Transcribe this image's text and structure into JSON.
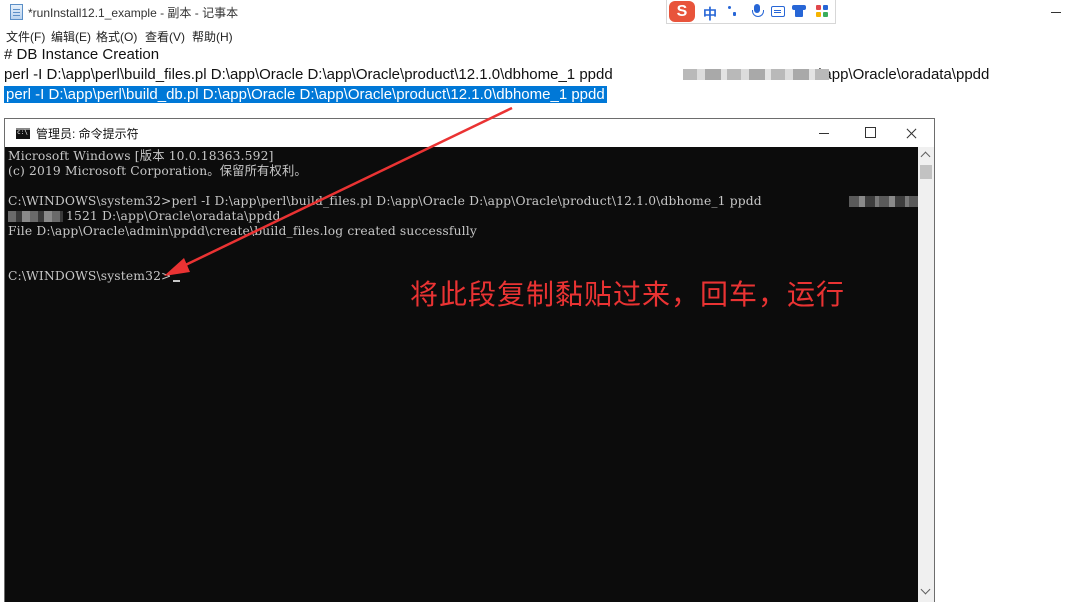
{
  "notepad": {
    "title": "*runInstall12.1_example - 副本 - 记事本",
    "menu": [
      "文件(F)",
      "编辑(E)",
      "格式(O)",
      "查看(V)",
      "帮助(H)"
    ],
    "lines": {
      "comment": "# DB Instance Creation",
      "files_cmd_start": "perl -I D:\\app\\perl\\build_files.pl D:\\app\\Oracle D:\\app\\Oracle\\product\\12.1.0\\dbhome_1 ppdd",
      "files_cmd_end": "1521 D:\\app\\Oracle\\oradata\\ppdd",
      "db_cmd_selected": "perl -I D:\\app\\perl\\build_db.pl D:\\app\\Oracle D:\\app\\Oracle\\product\\12.1.0\\dbhome_1 ppdd"
    }
  },
  "ime": {
    "logo": "S",
    "mode": "中",
    "icons": [
      "punctuation-icon",
      "microphone-icon",
      "keyboard-icon",
      "skin-icon",
      "toolbox-icon"
    ]
  },
  "cmd": {
    "title": "管理员: 命令提示符",
    "lines": {
      "version": "Microsoft Windows [版本 10.0.18363.592]",
      "copyright": "(c) 2019 Microsoft Corporation。保留所有权利。",
      "command": "C:\\WINDOWS\\system32>perl -I D:\\app\\perl\\build_files.pl D:\\app\\Oracle D:\\app\\Oracle\\product\\12.1.0\\dbhome_1 ppdd",
      "command_cont": "1521 D:\\app\\Oracle\\oradata\\ppdd",
      "result": "File D:\\app\\Oracle\\admin\\ppdd\\create\\build_files.log created successfully",
      "prompt": "C:\\WINDOWS\\system32>"
    }
  },
  "annotation": {
    "text": "将此段复制黏贴过来，回车，运行",
    "color": "#ea3333"
  },
  "colors": {
    "selection": "#0078d7",
    "console_bg": "#0c0c0c",
    "console_text": "#c7c7c7"
  }
}
